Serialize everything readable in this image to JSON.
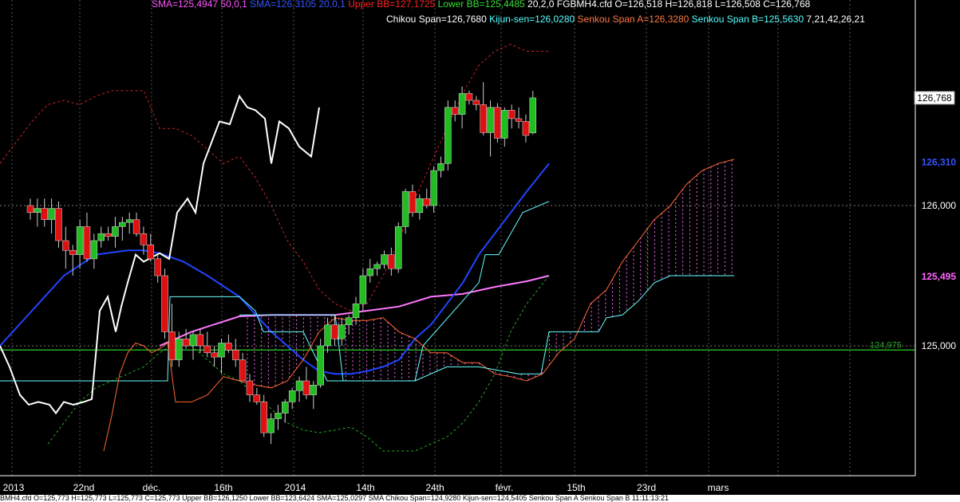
{
  "header": {
    "line1": [
      {
        "text": "SMA=125,4947  50,0,1",
        "color": "#ff55ff"
      },
      {
        "text": "SMA=126,3105  20,0,1",
        "color": "#3355ff"
      },
      {
        "text": "Upper BB=127,1725",
        "color": "#ff2222"
      },
      {
        "text": "Lower BB=125,4485",
        "color": "#33dd33"
      },
      {
        "text": "20,2,0",
        "color": "#ffffff"
      },
      {
        "text": "FGBMH4.cfd O=126,518 H=126,818 L=126,508 C=126,768",
        "color": "#ffffff"
      }
    ],
    "line2": [
      {
        "text": "Chikou Span=126,7680",
        "color": "#ffffff"
      },
      {
        "text": "Kijun-sen=126,0280",
        "color": "#55ffff"
      },
      {
        "text": "Senkou Span A=126,3280",
        "color": "#ff7744"
      },
      {
        "text": "Senkou Span B=125,5630",
        "color": "#55ffff"
      },
      {
        "text": "7,21,42,26,21",
        "color": "#ffffff"
      }
    ]
  },
  "status_bar": "BMH4.cfd O=125,773 H=125,773 L=125,773 C=125,773  Upper BB=126,1250 Lower BB=123,6424 SMA=125,0297 SMA    Chikou Span=124,9280 Kijun-sen=124,5405 Senkou Span A    Senkou Span B    11:11:13:21",
  "colors": {
    "background": "#000000",
    "up_candle": "#22bb22",
    "down_candle": "#dd1111",
    "sma50": "#ff77ff",
    "sma20": "#2244ff",
    "upper_bb": "#cc2222",
    "lower_bb": "#22aa22",
    "chikou": "#ffffff",
    "kijun": "#66ffff",
    "senkou_a": "#ff6633",
    "senkou_b": "#66ffff",
    "cloud": "#ff66ff",
    "hline": "#22aa22"
  },
  "chart_data": {
    "type": "candlestick",
    "instrument": "FGBMH4.cfd",
    "ylim": [
      124.23,
      127.15
    ],
    "y_ticks": [
      125.0,
      126.0
    ],
    "grid": true,
    "x_labels": [
      "2013",
      "22nd",
      "déc.",
      "16th",
      "2014",
      "14th",
      "24th",
      "févr.",
      "15th",
      "23rd",
      "mars"
    ],
    "price_labels": [
      {
        "text": "126,768",
        "value": 126.768,
        "style": "boxed"
      },
      {
        "text": "126,310",
        "value": 126.31,
        "color": "#3355ff"
      },
      {
        "text": "126,000",
        "value": 126.0,
        "color": "#ffffff"
      },
      {
        "text": "125,495",
        "value": 125.495,
        "color": "#ff66ff"
      },
      {
        "text": "125,000",
        "value": 125.0,
        "color": "#ffffff"
      }
    ],
    "hline": {
      "value": 124.97,
      "label": "124,975"
    },
    "candles_x_start": 38,
    "candles_dx": 8.87,
    "candles": [
      [
        126.0,
        126.05,
        125.9,
        125.95
      ],
      [
        125.95,
        126.05,
        125.85,
        125.98
      ],
      [
        125.98,
        126.05,
        125.85,
        125.9
      ],
      [
        125.9,
        126.05,
        125.8,
        125.98
      ],
      [
        125.98,
        126.03,
        125.7,
        125.75
      ],
      [
        125.75,
        125.85,
        125.55,
        125.68
      ],
      [
        125.68,
        125.72,
        125.5,
        125.65
      ],
      [
        125.65,
        125.9,
        125.55,
        125.85
      ],
      [
        125.85,
        125.95,
        125.6,
        125.62
      ],
      [
        125.62,
        125.8,
        125.55,
        125.75
      ],
      [
        125.75,
        125.85,
        125.7,
        125.8
      ],
      [
        125.8,
        125.85,
        125.75,
        125.78
      ],
      [
        125.78,
        125.92,
        125.7,
        125.85
      ],
      [
        125.85,
        125.92,
        125.75,
        125.88
      ],
      [
        125.88,
        125.95,
        125.8,
        125.9
      ],
      [
        125.9,
        125.95,
        125.78,
        125.8
      ],
      [
        125.8,
        125.85,
        125.65,
        125.72
      ],
      [
        125.72,
        125.8,
        125.6,
        125.62
      ],
      [
        125.62,
        125.65,
        125.45,
        125.5
      ],
      [
        125.5,
        125.55,
        125.05,
        125.1
      ],
      [
        125.1,
        125.3,
        124.85,
        124.9
      ],
      [
        124.9,
        125.1,
        124.85,
        125.05
      ],
      [
        125.05,
        125.12,
        124.98,
        125.0
      ],
      [
        125.0,
        125.1,
        124.9,
        125.08
      ],
      [
        125.08,
        125.12,
        124.95,
        125.0
      ],
      [
        125.0,
        125.1,
        124.92,
        124.95
      ],
      [
        124.95,
        125.0,
        124.85,
        124.92
      ],
      [
        124.92,
        125.05,
        124.8,
        125.02
      ],
      [
        125.02,
        125.08,
        124.95,
        124.97
      ],
      [
        124.97,
        125.05,
        124.85,
        124.9
      ],
      [
        124.9,
        124.95,
        124.75,
        124.75
      ],
      [
        124.75,
        124.8,
        124.6,
        124.65
      ],
      [
        124.65,
        124.7,
        124.58,
        124.6
      ],
      [
        124.6,
        124.65,
        124.35,
        124.38
      ],
      [
        124.38,
        124.52,
        124.3,
        124.48
      ],
      [
        124.48,
        124.58,
        124.4,
        124.52
      ],
      [
        124.52,
        124.62,
        124.45,
        124.6
      ],
      [
        124.6,
        124.7,
        124.55,
        124.68
      ],
      [
        124.68,
        124.78,
        124.6,
        124.75
      ],
      [
        124.75,
        124.85,
        124.62,
        124.65
      ],
      [
        124.65,
        124.75,
        124.55,
        124.72
      ],
      [
        124.72,
        125.05,
        124.7,
        125.0
      ],
      [
        125.0,
        125.2,
        124.95,
        125.15
      ],
      [
        125.15,
        125.22,
        125.0,
        125.05
      ],
      [
        125.05,
        125.2,
        125.0,
        125.15
      ],
      [
        125.15,
        125.22,
        125.08,
        125.2
      ],
      [
        125.2,
        125.35,
        125.15,
        125.3
      ],
      [
        125.3,
        125.55,
        125.25,
        125.5
      ],
      [
        125.5,
        125.62,
        125.45,
        125.55
      ],
      [
        125.55,
        125.6,
        125.5,
        125.58
      ],
      [
        125.58,
        125.68,
        125.55,
        125.65
      ],
      [
        125.65,
        125.7,
        125.5,
        125.55
      ],
      [
        125.55,
        125.88,
        125.52,
        125.85
      ],
      [
        125.85,
        126.12,
        125.8,
        126.1
      ],
      [
        126.1,
        126.15,
        125.92,
        125.95
      ],
      [
        125.95,
        126.08,
        125.9,
        126.05
      ],
      [
        126.05,
        126.12,
        125.98,
        126.0
      ],
      [
        126.0,
        126.28,
        125.95,
        126.25
      ],
      [
        126.25,
        126.35,
        126.2,
        126.3
      ],
      [
        126.3,
        126.75,
        126.25,
        126.7
      ],
      [
        126.7,
        126.75,
        126.6,
        126.65
      ],
      [
        126.65,
        126.85,
        126.55,
        126.8
      ],
      [
        126.8,
        126.82,
        126.72,
        126.75
      ],
      [
        126.75,
        126.78,
        126.68,
        126.72
      ],
      [
        126.72,
        126.88,
        126.5,
        126.52
      ],
      [
        126.52,
        126.75,
        126.35,
        126.7
      ],
      [
        126.7,
        126.73,
        126.45,
        126.48
      ],
      [
        126.48,
        126.7,
        126.42,
        126.68
      ],
      [
        126.68,
        126.72,
        126.55,
        126.62
      ],
      [
        126.62,
        126.7,
        126.55,
        126.6
      ],
      [
        126.6,
        126.65,
        126.45,
        126.5
      ],
      [
        126.518,
        126.818,
        126.508,
        126.768
      ]
    ],
    "series": [
      {
        "name": "SMA",
        "key": "sma50",
        "x": [
          0,
          23,
          60,
          110,
          175,
          220,
          280,
          320,
          360,
          400,
          440,
          480,
          520,
          560,
          600,
          640,
          688
        ],
        "y": [
          125.3,
          125.2,
          125.3,
          125.35,
          125.2,
          125.1,
          124.95,
          124.9,
          124.85,
          124.9,
          125.0,
          125.1,
          125.15,
          125.25,
          125.3,
          125.4,
          125.45
        ]
      },
      {
        "name": "SMA",
        "key": "sma50_vis",
        "x": [
          200,
          240,
          300,
          340,
          380,
          420,
          460,
          500,
          540,
          580,
          620,
          660,
          688
        ],
        "y": [
          125.0,
          125.1,
          125.21,
          125.22,
          125.22,
          125.22,
          125.25,
          125.28,
          125.35,
          125.37,
          125.42,
          125.46,
          125.5
        ]
      },
      {
        "name": "SMA",
        "key": "sma20",
        "x": [
          0,
          40,
          80,
          120,
          160,
          180,
          200,
          230,
          260,
          300,
          340,
          380,
          400,
          420,
          440,
          460,
          480,
          500,
          520,
          540,
          560,
          580,
          600,
          620,
          640,
          660,
          688
        ],
        "y": [
          125.0,
          125.25,
          125.5,
          125.65,
          125.68,
          125.68,
          125.66,
          125.6,
          125.5,
          125.35,
          125.1,
          124.9,
          124.82,
          124.8,
          124.8,
          124.82,
          124.85,
          124.9,
          125.05,
          125.15,
          125.3,
          125.45,
          125.65,
          125.8,
          125.95,
          126.1,
          126.3
        ]
      },
      {
        "name": "Upper BB",
        "key": "upper_bb",
        "x": [
          0,
          20,
          40,
          60,
          80,
          100,
          120,
          140,
          160,
          180,
          200,
          220,
          240,
          260,
          280,
          300,
          320,
          340,
          360,
          380,
          400,
          420,
          440,
          460,
          480,
          500,
          520,
          540,
          560,
          580,
          600,
          620,
          640,
          660,
          688
        ],
        "y": [
          126.3,
          126.45,
          126.6,
          126.72,
          126.75,
          126.72,
          126.78,
          126.82,
          126.82,
          126.82,
          126.55,
          126.55,
          126.5,
          126.4,
          126.3,
          126.35,
          126.2,
          126.0,
          125.75,
          125.6,
          125.4,
          125.3,
          125.25,
          125.3,
          125.5,
          125.75,
          126.05,
          126.3,
          126.55,
          126.8,
          127.0,
          127.1,
          127.15,
          127.1,
          127.1
        ]
      },
      {
        "name": "Lower BB",
        "key": "lower_bb",
        "x": [
          60,
          80,
          100,
          120,
          140,
          160,
          180,
          200,
          220,
          240,
          260,
          280,
          300,
          320,
          340,
          360,
          380,
          400,
          420,
          440,
          460,
          480,
          500,
          520,
          540,
          560,
          580,
          600,
          620,
          640,
          660,
          688
        ],
        "y": [
          124.3,
          124.45,
          124.6,
          124.7,
          124.75,
          124.8,
          124.85,
          124.95,
          125.02,
          125.0,
          124.9,
          124.8,
          124.75,
          124.65,
          124.55,
          124.45,
          124.4,
          124.38,
          124.4,
          124.42,
          124.35,
          124.25,
          124.25,
          124.25,
          124.3,
          124.35,
          124.45,
          124.6,
          124.8,
          125.1,
          125.3,
          125.5
        ]
      },
      {
        "name": "Chikou Span",
        "key": "chikou",
        "x": [
          0,
          12,
          25,
          36,
          48,
          62,
          70,
          80,
          92,
          105,
          115,
          125,
          135,
          145,
          152,
          160,
          170,
          180,
          190,
          200,
          212,
          222,
          235,
          245,
          255,
          265,
          275,
          288,
          300,
          310,
          320,
          332,
          340,
          350,
          362,
          375,
          390,
          400
        ],
        "y": [
          125.0,
          124.85,
          124.65,
          124.58,
          124.6,
          124.58,
          124.52,
          124.6,
          124.58,
          124.6,
          124.62,
          125.25,
          125.35,
          125.1,
          125.28,
          125.45,
          125.65,
          125.6,
          125.63,
          125.66,
          125.62,
          125.95,
          126.05,
          125.95,
          126.3,
          126.45,
          126.6,
          126.58,
          126.78,
          126.7,
          126.68,
          126.62,
          126.3,
          126.6,
          126.55,
          126.42,
          126.35,
          126.7
        ]
      },
      {
        "name": "Kijun-sen",
        "key": "kijun",
        "x": [
          0,
          210,
          213,
          222,
          300,
          320,
          330,
          380,
          410,
          420,
          520,
          530,
          600,
          608,
          625,
          655,
          688
        ],
        "y": [
          124.75,
          124.75,
          125.35,
          125.35,
          125.35,
          125.25,
          125.1,
          125.1,
          124.75,
          124.75,
          124.75,
          125.0,
          125.45,
          125.65,
          125.65,
          125.95,
          126.03
        ]
      },
      {
        "name": "Senkou Span A",
        "key": "senkou_a",
        "x": [
          130,
          140,
          150,
          160,
          170,
          180,
          190,
          200,
          210,
          220,
          230,
          240,
          260,
          280,
          300,
          320,
          340,
          360,
          380,
          400,
          420,
          440,
          460,
          480,
          500,
          520,
          540,
          560,
          580,
          600,
          620,
          640,
          660,
          680,
          700,
          720,
          740,
          760,
          780,
          800,
          820,
          840,
          860,
          880,
          900,
          920
        ],
        "y": [
          124.25,
          124.5,
          124.8,
          124.95,
          125.02,
          125.0,
          124.95,
          124.98,
          125.02,
          124.6,
          124.6,
          124.6,
          124.65,
          124.78,
          124.75,
          124.72,
          124.7,
          124.75,
          124.9,
          125.1,
          125.2,
          125.18,
          125.18,
          125.2,
          125.1,
          125.05,
          124.95,
          124.95,
          124.88,
          124.88,
          124.8,
          124.78,
          124.75,
          124.8,
          124.95,
          125.05,
          125.3,
          125.4,
          125.6,
          125.75,
          125.9,
          126.0,
          126.15,
          126.25,
          126.3,
          126.33
        ]
      },
      {
        "name": "Senkou Span B",
        "key": "senkou_b",
        "x": [
          300,
          310,
          330,
          380,
          420,
          430,
          520,
          560,
          600,
          650,
          660,
          678,
          688,
          750,
          760,
          780,
          800,
          820,
          840,
          920
        ],
        "y": [
          125.22,
          125.22,
          125.22,
          125.22,
          125.22,
          124.75,
          124.75,
          124.85,
          124.85,
          124.8,
          124.8,
          124.8,
          125.1,
          125.1,
          125.2,
          125.22,
          125.32,
          125.45,
          125.5,
          125.5
        ]
      }
    ],
    "cloud_region": {
      "x_from": 310,
      "x_to": 920
    }
  }
}
